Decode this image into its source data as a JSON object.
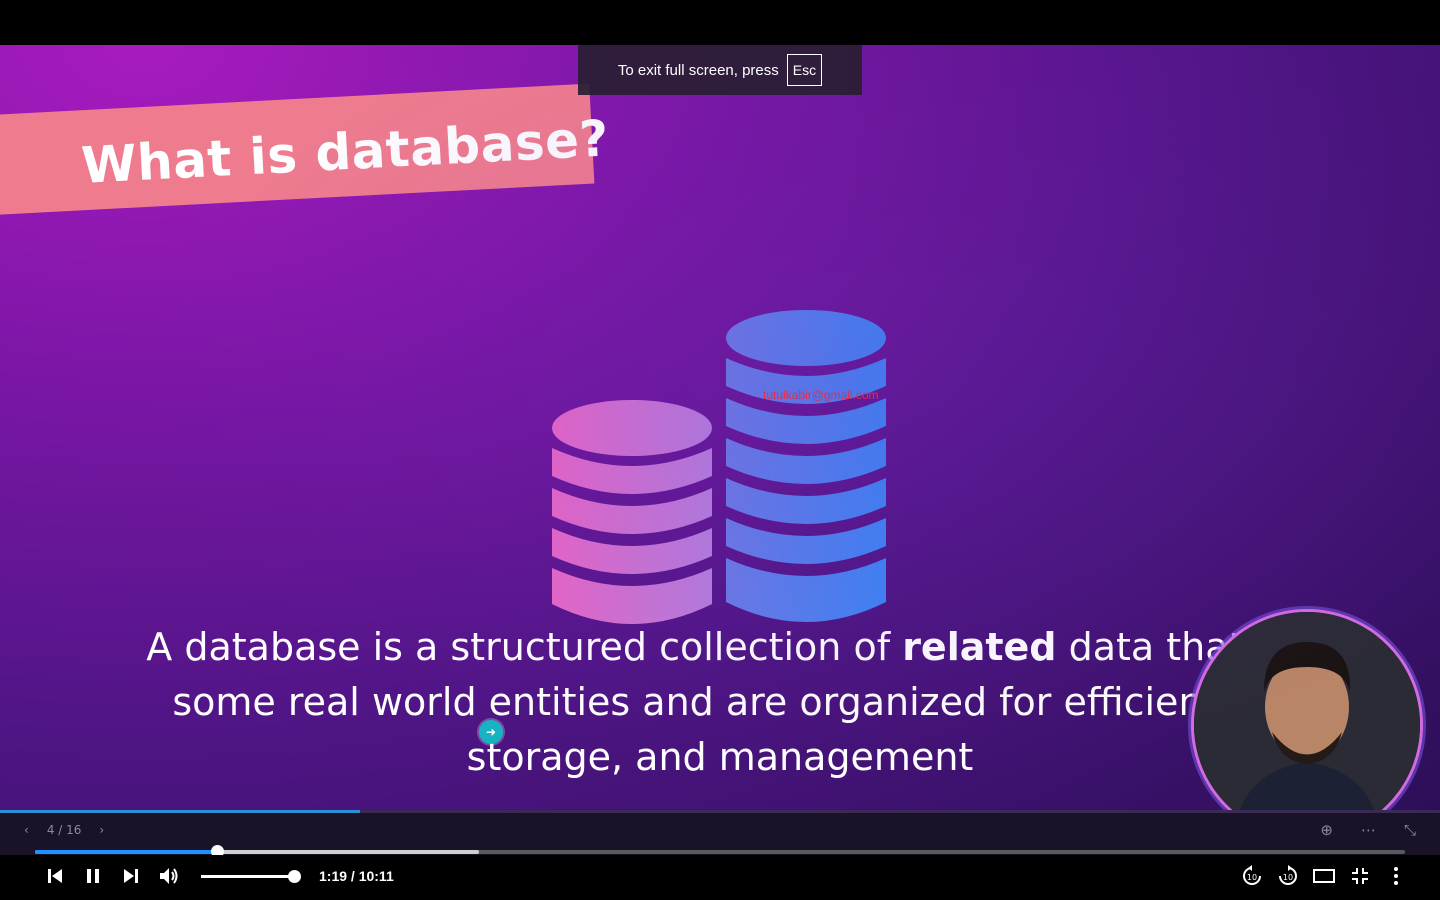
{
  "fullscreen_notice": {
    "text": "To exit full screen, press",
    "key": "Esc"
  },
  "slide": {
    "title": "What is database?",
    "caption_before": "A database is a structured collection of ",
    "caption_bold": "related",
    "caption_after": " data that re",
    "caption_line2": "some real world entities and are organized for efficient re",
    "caption_line3": "storage, and management",
    "watermark": "tutulkabir@gmail.com",
    "page_indicator": "4 / 16",
    "progress_fraction": 0.25
  },
  "player": {
    "time": "1:19 / 10:11",
    "played_fraction": 0.1325,
    "buffered_fraction": 0.324,
    "volume_fraction": 1.0
  },
  "colors": {
    "banner": "#ef7c8e",
    "accent": "#1e90ff",
    "watermark": "#ff2a2a"
  }
}
